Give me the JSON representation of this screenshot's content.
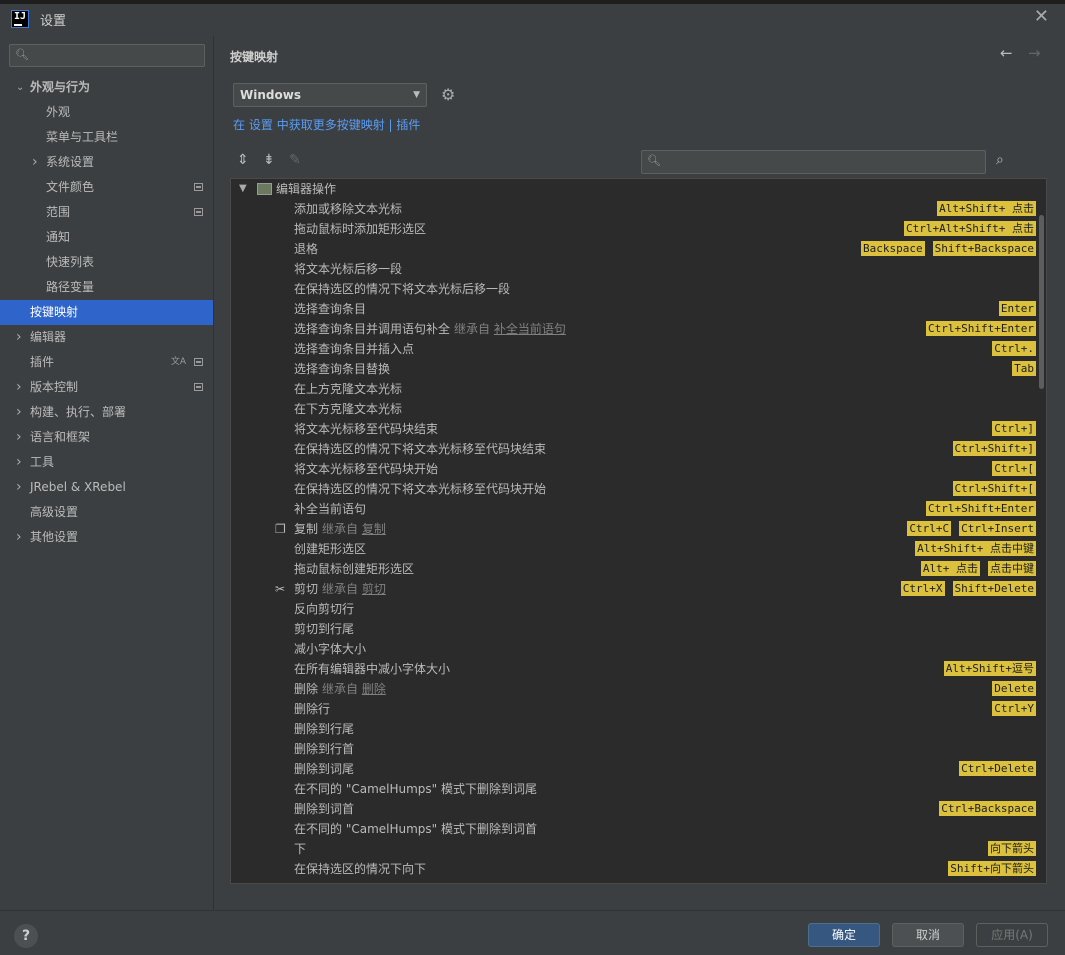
{
  "window": {
    "title": "设置",
    "close_glyph": "✕"
  },
  "sidebar": {
    "search_placeholder": "",
    "items": [
      {
        "label": "外观与行为",
        "indent": 0,
        "arrow": "expanded",
        "bold": true
      },
      {
        "label": "外观",
        "indent": 1
      },
      {
        "label": "菜单与工具栏",
        "indent": 1
      },
      {
        "label": "系统设置",
        "indent": 1,
        "arrow": "collapsed"
      },
      {
        "label": "文件颜色",
        "indent": 1,
        "project_mark": true
      },
      {
        "label": "范围",
        "indent": 1,
        "project_mark": true
      },
      {
        "label": "通知",
        "indent": 1
      },
      {
        "label": "快速列表",
        "indent": 1
      },
      {
        "label": "路径变量",
        "indent": 1
      },
      {
        "label": "按键映射",
        "indent": 0,
        "selected": true
      },
      {
        "label": "编辑器",
        "indent": 0,
        "arrow": "collapsed"
      },
      {
        "label": "插件",
        "indent": 0,
        "project_mark": true,
        "lang_icon": true
      },
      {
        "label": "版本控制",
        "indent": 0,
        "arrow": "collapsed",
        "project_mark": true
      },
      {
        "label": "构建、执行、部署",
        "indent": 0,
        "arrow": "collapsed"
      },
      {
        "label": "语言和框架",
        "indent": 0,
        "arrow": "collapsed"
      },
      {
        "label": "工具",
        "indent": 0,
        "arrow": "collapsed"
      },
      {
        "label": "JRebel & XRebel",
        "indent": 0,
        "arrow": "collapsed"
      },
      {
        "label": "高级设置",
        "indent": 0
      },
      {
        "label": "其他设置",
        "indent": 0,
        "arrow": "collapsed"
      }
    ]
  },
  "main": {
    "heading": "按键映射",
    "keymap_select": "Windows",
    "hint": {
      "prefix": "在",
      "link1": "设置",
      "middle": "中获取更多按键映射 |",
      "link2": "插件"
    },
    "search_placeholder": "",
    "group_label": "编辑器操作",
    "inherit_label": "继承自",
    "actions": [
      {
        "name": "添加或移除文本光标",
        "keys": [
          "Alt+Shift+ 点击"
        ]
      },
      {
        "name": "拖动鼠标时添加矩形选区",
        "keys": [
          "Ctrl+Alt+Shift+ 点击"
        ]
      },
      {
        "name": "退格",
        "keys": [
          "Backspace",
          "Shift+Backspace"
        ]
      },
      {
        "name": "将文本光标后移一段",
        "keys": []
      },
      {
        "name": "在保持选区的情况下将文本光标后移一段",
        "keys": []
      },
      {
        "name": "选择查询条目",
        "keys": [
          "Enter"
        ]
      },
      {
        "name": "选择查询条目并调用语句补全",
        "inherit": "补全当前语句",
        "keys": [
          "Ctrl+Shift+Enter"
        ]
      },
      {
        "name": "选择查询条目并插入点",
        "keys": [
          "Ctrl+."
        ]
      },
      {
        "name": "选择查询条目替换",
        "keys": [
          "Tab"
        ]
      },
      {
        "name": "在上方克隆文本光标",
        "keys": []
      },
      {
        "name": "在下方克隆文本光标",
        "keys": []
      },
      {
        "name": "将文本光标移至代码块结束",
        "keys": [
          "Ctrl+]"
        ]
      },
      {
        "name": "在保持选区的情况下将文本光标移至代码块结束",
        "keys": [
          "Ctrl+Shift+]"
        ]
      },
      {
        "name": "将文本光标移至代码块开始",
        "keys": [
          "Ctrl+["
        ]
      },
      {
        "name": "在保持选区的情况下将文本光标移至代码块开始",
        "keys": [
          "Ctrl+Shift+["
        ]
      },
      {
        "name": "补全当前语句",
        "keys": [
          "Ctrl+Shift+Enter"
        ]
      },
      {
        "name": "复制",
        "icon": "copy",
        "inherit": "复制",
        "keys": [
          "Ctrl+C",
          "Ctrl+Insert"
        ]
      },
      {
        "name": "创建矩形选区",
        "keys": [
          "Alt+Shift+ 点击中键"
        ]
      },
      {
        "name": "拖动鼠标创建矩形选区",
        "keys": [
          "Alt+ 点击",
          "点击中键"
        ]
      },
      {
        "name": "剪切",
        "icon": "cut",
        "inherit": "剪切",
        "keys": [
          "Ctrl+X",
          "Shift+Delete"
        ]
      },
      {
        "name": "反向剪切行",
        "keys": []
      },
      {
        "name": "剪切到行尾",
        "keys": []
      },
      {
        "name": "减小字体大小",
        "keys": []
      },
      {
        "name": "在所有编辑器中减小字体大小",
        "keys": [
          "Alt+Shift+逗号"
        ]
      },
      {
        "name": "删除",
        "inherit": "删除",
        "keys": [
          "Delete"
        ]
      },
      {
        "name": "删除行",
        "keys": [
          "Ctrl+Y"
        ]
      },
      {
        "name": "删除到行尾",
        "keys": []
      },
      {
        "name": "删除到行首",
        "keys": []
      },
      {
        "name": "删除到词尾",
        "keys": [
          "Ctrl+Delete"
        ]
      },
      {
        "name": "在不同的 \"CamelHumps\" 模式下删除到词尾",
        "keys": []
      },
      {
        "name": "删除到词首",
        "keys": [
          "Ctrl+Backspace"
        ]
      },
      {
        "name": "在不同的 \"CamelHumps\" 模式下删除到词首",
        "keys": []
      },
      {
        "name": "下",
        "keys": [
          "向下箭头"
        ]
      },
      {
        "name": "在保持选区的情况下向下",
        "keys": [
          "Shift+向下箭头"
        ]
      }
    ]
  },
  "footer": {
    "help": "?",
    "ok": "确定",
    "cancel": "取消",
    "apply": "应用(A)"
  },
  "colors": {
    "selection": "#2f65ca",
    "shortcut_badge": "#dcc13e",
    "link": "#589df6",
    "ok_button": "#365880"
  }
}
